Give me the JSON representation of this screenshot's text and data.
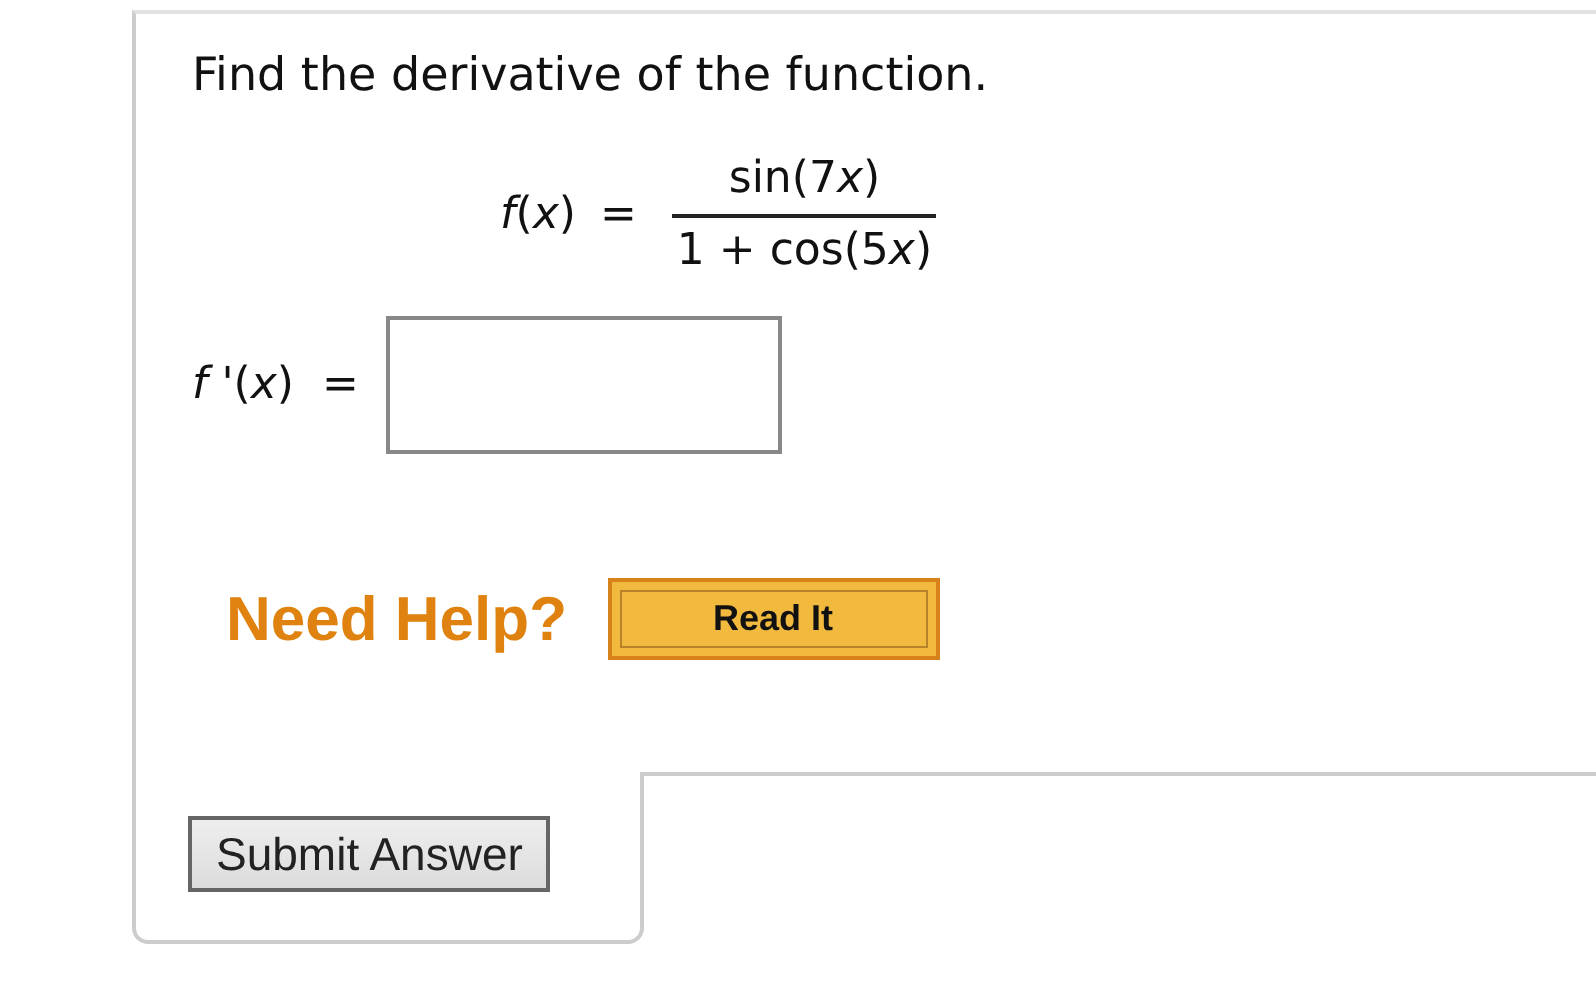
{
  "question": {
    "prompt": "Find the derivative of the function.",
    "function": {
      "lhs": "*f*(*x*)",
      "equals": "=",
      "numerator": [
        {
          "text": "sin(7",
          "italic": false
        },
        {
          "text": "x",
          "italic": true
        },
        {
          "text": ")",
          "italic": false
        }
      ],
      "denominator": [
        {
          "text": "1 + cos(5",
          "italic": false
        },
        {
          "text": "x",
          "italic": true
        },
        {
          "text": ")",
          "italic": false
        }
      ]
    },
    "answer": {
      "label": "*f* '(*x*)",
      "equals": "="
    }
  },
  "help": {
    "label": "Need Help?",
    "buttons": [
      "Read It"
    ]
  },
  "submit_button": "Submit Answer"
}
